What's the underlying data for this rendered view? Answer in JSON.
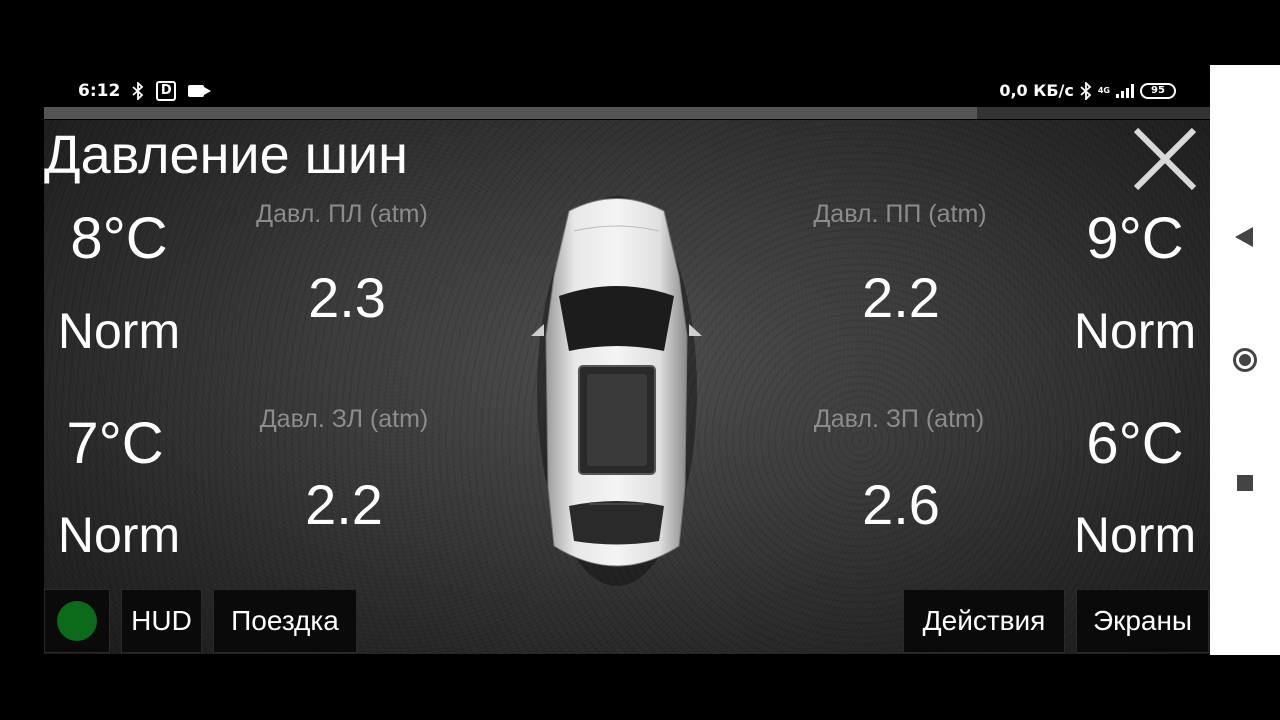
{
  "statusbar": {
    "time": "6:12",
    "network_speed": "0,0 КБ/с",
    "network_type": "4G",
    "battery": "95",
    "bluetooth_icon": "bluetooth-icon",
    "d_icon_letter": "D"
  },
  "progress": {
    "fraction": 0.8
  },
  "app": {
    "title": "Давление шин",
    "close_icon": "close-icon",
    "tires": {
      "front_left": {
        "temp": "8°C",
        "status": "Norm",
        "label": "Давл. ПЛ (atm)",
        "pressure": "2.3"
      },
      "front_right": {
        "temp": "9°C",
        "status": "Norm",
        "label": "Давл. ПП (atm)",
        "pressure": "2.2"
      },
      "rear_left": {
        "temp": "7°C",
        "status": "Norm",
        "label": "Давл. ЗЛ (atm)",
        "pressure": "2.2"
      },
      "rear_right": {
        "temp": "6°C",
        "status": "Norm",
        "label": "Давл. ЗП (atm)",
        "pressure": "2.6"
      }
    },
    "buttons": {
      "hud": "HUD",
      "trip": "Поездка",
      "actions": "Действия",
      "screens": "Экраны"
    },
    "colors": {
      "indicator": "#0c6b1a",
      "label_gray": "#8c8c8c"
    }
  }
}
